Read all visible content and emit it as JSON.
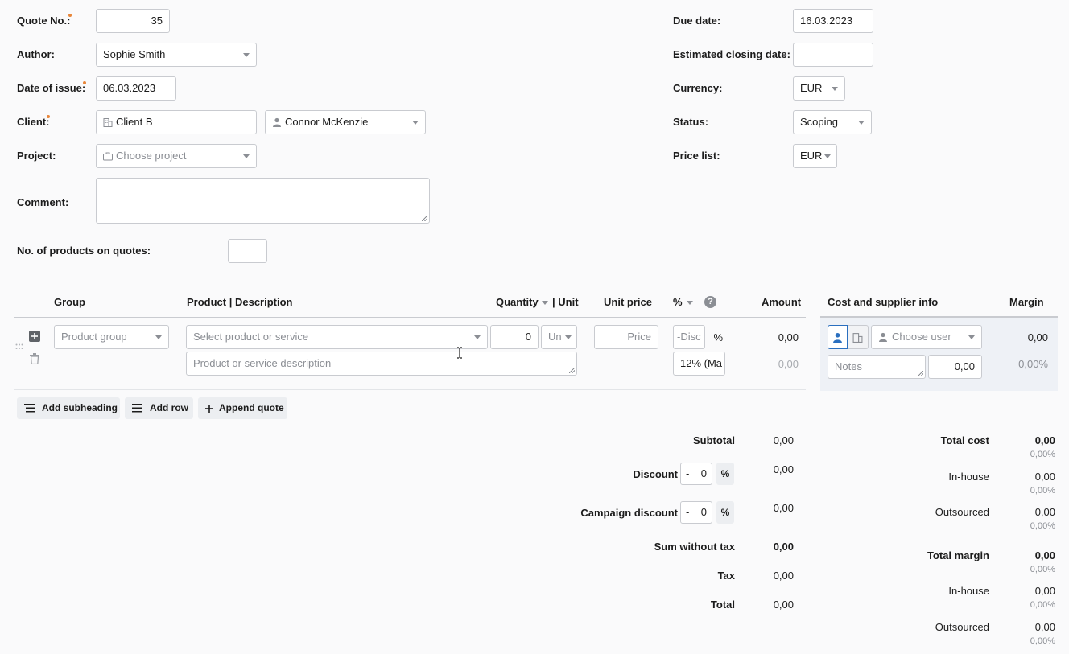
{
  "form": {
    "quote_no": {
      "label": "Quote No.:",
      "value": "35"
    },
    "author": {
      "label": "Author:",
      "value": "Sophie Smith"
    },
    "date_of_issue": {
      "label": "Date of issue:",
      "value": "06.03.2023"
    },
    "client": {
      "label": "Client:",
      "client_value": "Client B",
      "contact_value": "Connor McKenzie"
    },
    "project": {
      "label": "Project:",
      "placeholder": "Choose project"
    },
    "comment": {
      "label": "Comment:",
      "value": ""
    },
    "products_count": {
      "label": "No. of products on quotes:",
      "value": ""
    },
    "due_date": {
      "label": "Due date:",
      "value": "16.03.2023"
    },
    "est_closing": {
      "label": "Estimated closing date:",
      "value": ""
    },
    "currency": {
      "label": "Currency:",
      "value": "EUR"
    },
    "status": {
      "label": "Status:",
      "value": "Scoping"
    },
    "price_list": {
      "label": "Price list:",
      "value": "EUR"
    }
  },
  "table": {
    "headers": {
      "group": "Group",
      "product": "Product | Description",
      "quantity": "Quantity",
      "unit": "| Unit",
      "unit_price": "Unit price",
      "percent": "%",
      "help": "?",
      "amount": "Amount",
      "cost": "Cost and supplier info",
      "margin": "Margin"
    },
    "row": {
      "group_placeholder": "Product group",
      "product_placeholder": "Select product or service",
      "description_placeholder": "Product or service description",
      "quantity": "0",
      "unit_placeholder": "Un",
      "price_placeholder": "Price",
      "discount_placeholder": "-Disc",
      "percent_sign": "%",
      "tax": "12% (Mä",
      "amount": "0,00",
      "amount_sub": "0,00",
      "user_placeholder": "Choose user",
      "notes_placeholder": "Notes",
      "cost": "0,00",
      "margin": "0,00",
      "margin_pct": "0,00%"
    }
  },
  "actions": {
    "add_subheading": "Add subheading",
    "add_row": "Add row",
    "append_quote": "Append quote"
  },
  "summary": {
    "subtotal": {
      "label": "Subtotal",
      "value": "0,00"
    },
    "discount": {
      "label": "Discount",
      "sign": "-",
      "input": "0",
      "pct": "%",
      "value": "0,00"
    },
    "campaign_discount": {
      "label": "Campaign discount",
      "sign": "-",
      "input": "0",
      "pct": "%",
      "value": "0,00"
    },
    "sum_without_tax": {
      "label": "Sum without tax",
      "value": "0,00"
    },
    "tax": {
      "label": "Tax",
      "value": "0,00"
    },
    "total": {
      "label": "Total",
      "value": "0,00"
    }
  },
  "costs": {
    "total_cost": {
      "label": "Total cost",
      "value": "0,00",
      "pct": "0,00%"
    },
    "cost_inhouse": {
      "label": "In-house",
      "value": "0,00",
      "pct": "0,00%"
    },
    "cost_outsourced": {
      "label": "Outsourced",
      "value": "0,00",
      "pct": "0,00%"
    },
    "total_margin": {
      "label": "Total margin",
      "value": "0,00",
      "pct": "0,00%"
    },
    "margin_inhouse": {
      "label": "In-house",
      "value": "0,00",
      "pct": "0,00%"
    },
    "margin_outsourced": {
      "label": "Outsourced",
      "value": "0,00",
      "pct": "0,00%"
    }
  },
  "colors": {
    "required_dot": "#e8863a",
    "accent_blue": "#2a6fbf",
    "cost_panel": "#eef1f6"
  }
}
